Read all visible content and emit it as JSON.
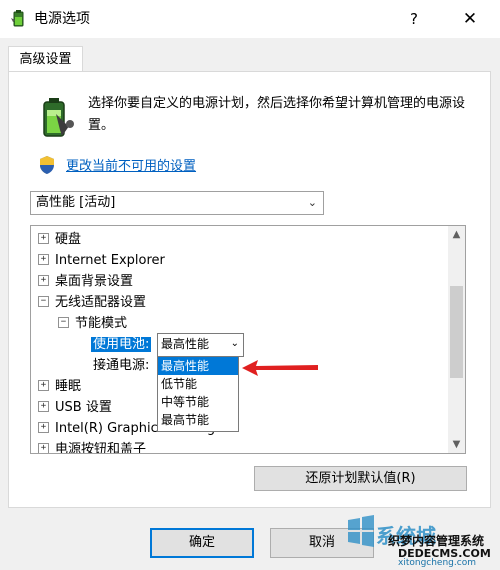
{
  "window": {
    "title": "电源选项",
    "help_label": "?",
    "close_label": "✕"
  },
  "tab": {
    "label": "高级设置"
  },
  "description": "选择你要自定义的电源计划，然后选择你希望计算机管理的电源设置。",
  "change_link": "更改当前不可用的设置",
  "plan_select": {
    "value": "高性能 [活动]"
  },
  "tree": {
    "items": [
      {
        "label": "硬盘",
        "expander": "+"
      },
      {
        "label": "Internet Explorer",
        "expander": "+"
      },
      {
        "label": "桌面背景设置",
        "expander": "+"
      },
      {
        "label": "无线适配器设置",
        "expander": "−"
      },
      {
        "label": "节能模式",
        "expander": "−"
      },
      {
        "label": "使用电池:"
      },
      {
        "label": "接通电源:"
      },
      {
        "label": "睡眠",
        "expander": "+"
      },
      {
        "label": "USB 设置",
        "expander": "+"
      },
      {
        "label": "Intel(R) Graphics Settings",
        "expander": "+"
      },
      {
        "label": "电源按钮和盖子",
        "expander": "+"
      }
    ],
    "battery_value": "最高性能",
    "dropdown_options": [
      "最高性能",
      "低节能",
      "中等节能",
      "最高节能"
    ],
    "dropdown_selected": "最高性能"
  },
  "buttons": {
    "restore": "还原计划默认值(R)",
    "ok": "确定",
    "cancel": "取消"
  },
  "watermark": {
    "line1": "系统城",
    "line2": "织梦内容管理系统",
    "line3": "DEDECMS.COM",
    "line4": "xitongcheng.com"
  },
  "colors": {
    "accent": "#0078d7",
    "link": "#0060c0",
    "arrow": "#e02020"
  },
  "icons": [
    "power-battery-icon",
    "shield-icon",
    "chevron-down-icon",
    "scroll-up-icon",
    "scroll-down-icon"
  ]
}
